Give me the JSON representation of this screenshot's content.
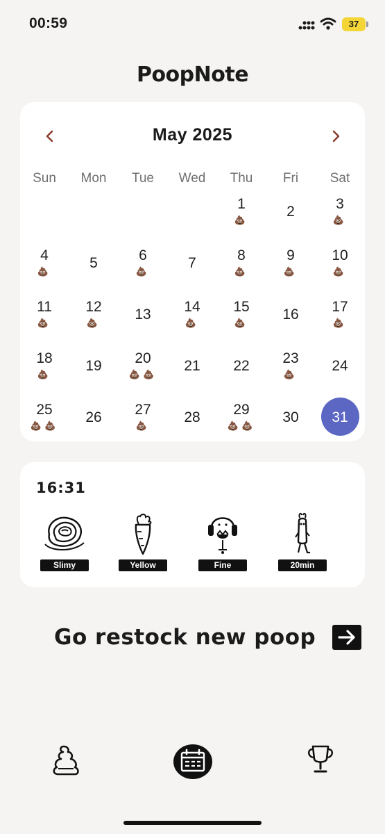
{
  "status_bar": {
    "time": "00:59",
    "battery": "37"
  },
  "app": {
    "title": "PoopNote"
  },
  "calendar": {
    "month_label": "May 2025",
    "prev_symbol": "‹",
    "next_symbol": "›",
    "weekdays": [
      "Sun",
      "Mon",
      "Tue",
      "Wed",
      "Thu",
      "Fri",
      "Sat"
    ],
    "days": [
      {
        "n": "1",
        "p": "💩"
      },
      {
        "n": "2",
        "p": ""
      },
      {
        "n": "3",
        "p": "💩"
      },
      {
        "n": "4",
        "p": "💩"
      },
      {
        "n": "5",
        "p": ""
      },
      {
        "n": "6",
        "p": "💩"
      },
      {
        "n": "7",
        "p": ""
      },
      {
        "n": "8",
        "p": "💩"
      },
      {
        "n": "9",
        "p": "💩"
      },
      {
        "n": "10",
        "p": "💩"
      },
      {
        "n": "11",
        "p": "💩"
      },
      {
        "n": "12",
        "p": "💩"
      },
      {
        "n": "13",
        "p": ""
      },
      {
        "n": "14",
        "p": "💩"
      },
      {
        "n": "15",
        "p": "💩"
      },
      {
        "n": "16",
        "p": ""
      },
      {
        "n": "17",
        "p": "💩"
      },
      {
        "n": "18",
        "p": "💩"
      },
      {
        "n": "19",
        "p": ""
      },
      {
        "n": "20",
        "p": "💩💩"
      },
      {
        "n": "21",
        "p": ""
      },
      {
        "n": "22",
        "p": ""
      },
      {
        "n": "23",
        "p": "💩"
      },
      {
        "n": "24",
        "p": ""
      },
      {
        "n": "25",
        "p": "💩💩"
      },
      {
        "n": "26",
        "p": ""
      },
      {
        "n": "27",
        "p": "💩"
      },
      {
        "n": "28",
        "p": ""
      },
      {
        "n": "29",
        "p": "💩💩"
      },
      {
        "n": "30",
        "p": ""
      },
      {
        "n": "31",
        "p": ""
      }
    ],
    "selected_day": "31",
    "accent_color": "#5c67c4"
  },
  "record": {
    "time": "16:31",
    "attributes": [
      {
        "label": "Slimy",
        "icon": "slimy-swirl-icon"
      },
      {
        "label": "Yellow",
        "icon": "carrot-icon"
      },
      {
        "label": "Fine",
        "icon": "headphones-face-icon"
      },
      {
        "label": "20min",
        "icon": "walking-figure-icon"
      }
    ]
  },
  "restock": {
    "label": "Go restock new poop",
    "icon": "arrow-right-icon"
  },
  "tab_bar": {
    "items": [
      {
        "name": "poop",
        "icon": "poop-icon"
      },
      {
        "name": "calendar",
        "icon": "calendar-icon"
      },
      {
        "name": "trophy",
        "icon": "trophy-icon"
      }
    ]
  }
}
